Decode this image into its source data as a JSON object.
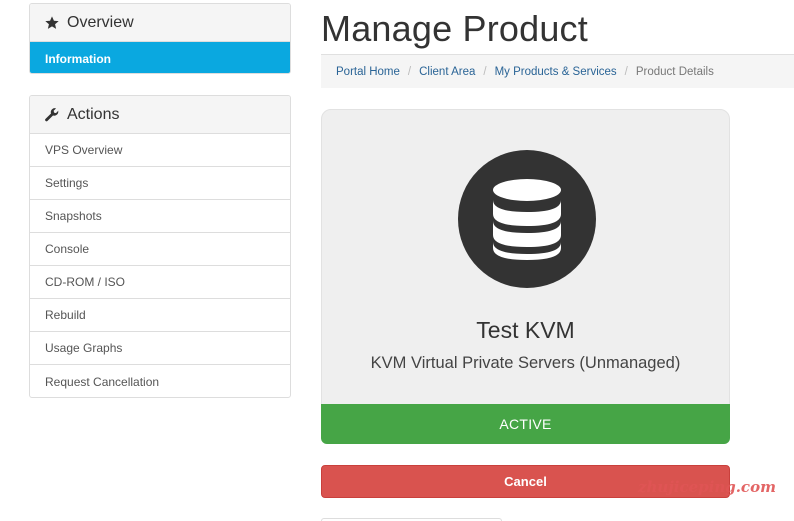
{
  "sidebar": {
    "overview": {
      "title": "Overview",
      "icon": "star-icon",
      "items": [
        {
          "label": "Information",
          "active": true
        }
      ]
    },
    "actions": {
      "title": "Actions",
      "icon": "wrench-icon",
      "items": [
        {
          "label": "VPS Overview"
        },
        {
          "label": "Settings"
        },
        {
          "label": "Snapshots"
        },
        {
          "label": "Console"
        },
        {
          "label": "CD-ROM / ISO"
        },
        {
          "label": "Rebuild"
        },
        {
          "label": "Usage Graphs"
        },
        {
          "label": "Request Cancellation"
        }
      ]
    }
  },
  "page": {
    "title": "Manage Product"
  },
  "breadcrumb": {
    "items": [
      {
        "label": "Portal Home"
      },
      {
        "label": "Client Area"
      },
      {
        "label": "My Products & Services"
      }
    ],
    "current": "Product Details",
    "separator": "/"
  },
  "product": {
    "icon": "database-icon",
    "name": "Test KVM",
    "group": "KVM Virtual Private Servers (Unmanaged)",
    "status": "ACTIVE"
  },
  "actions": {
    "cancel_label": "Cancel"
  },
  "watermark": "zhujiceping.com",
  "colors": {
    "active_nav": "#0aa8e0",
    "status_active": "#46a546",
    "cancel": "#d9534f",
    "icon_circle": "#333333"
  }
}
